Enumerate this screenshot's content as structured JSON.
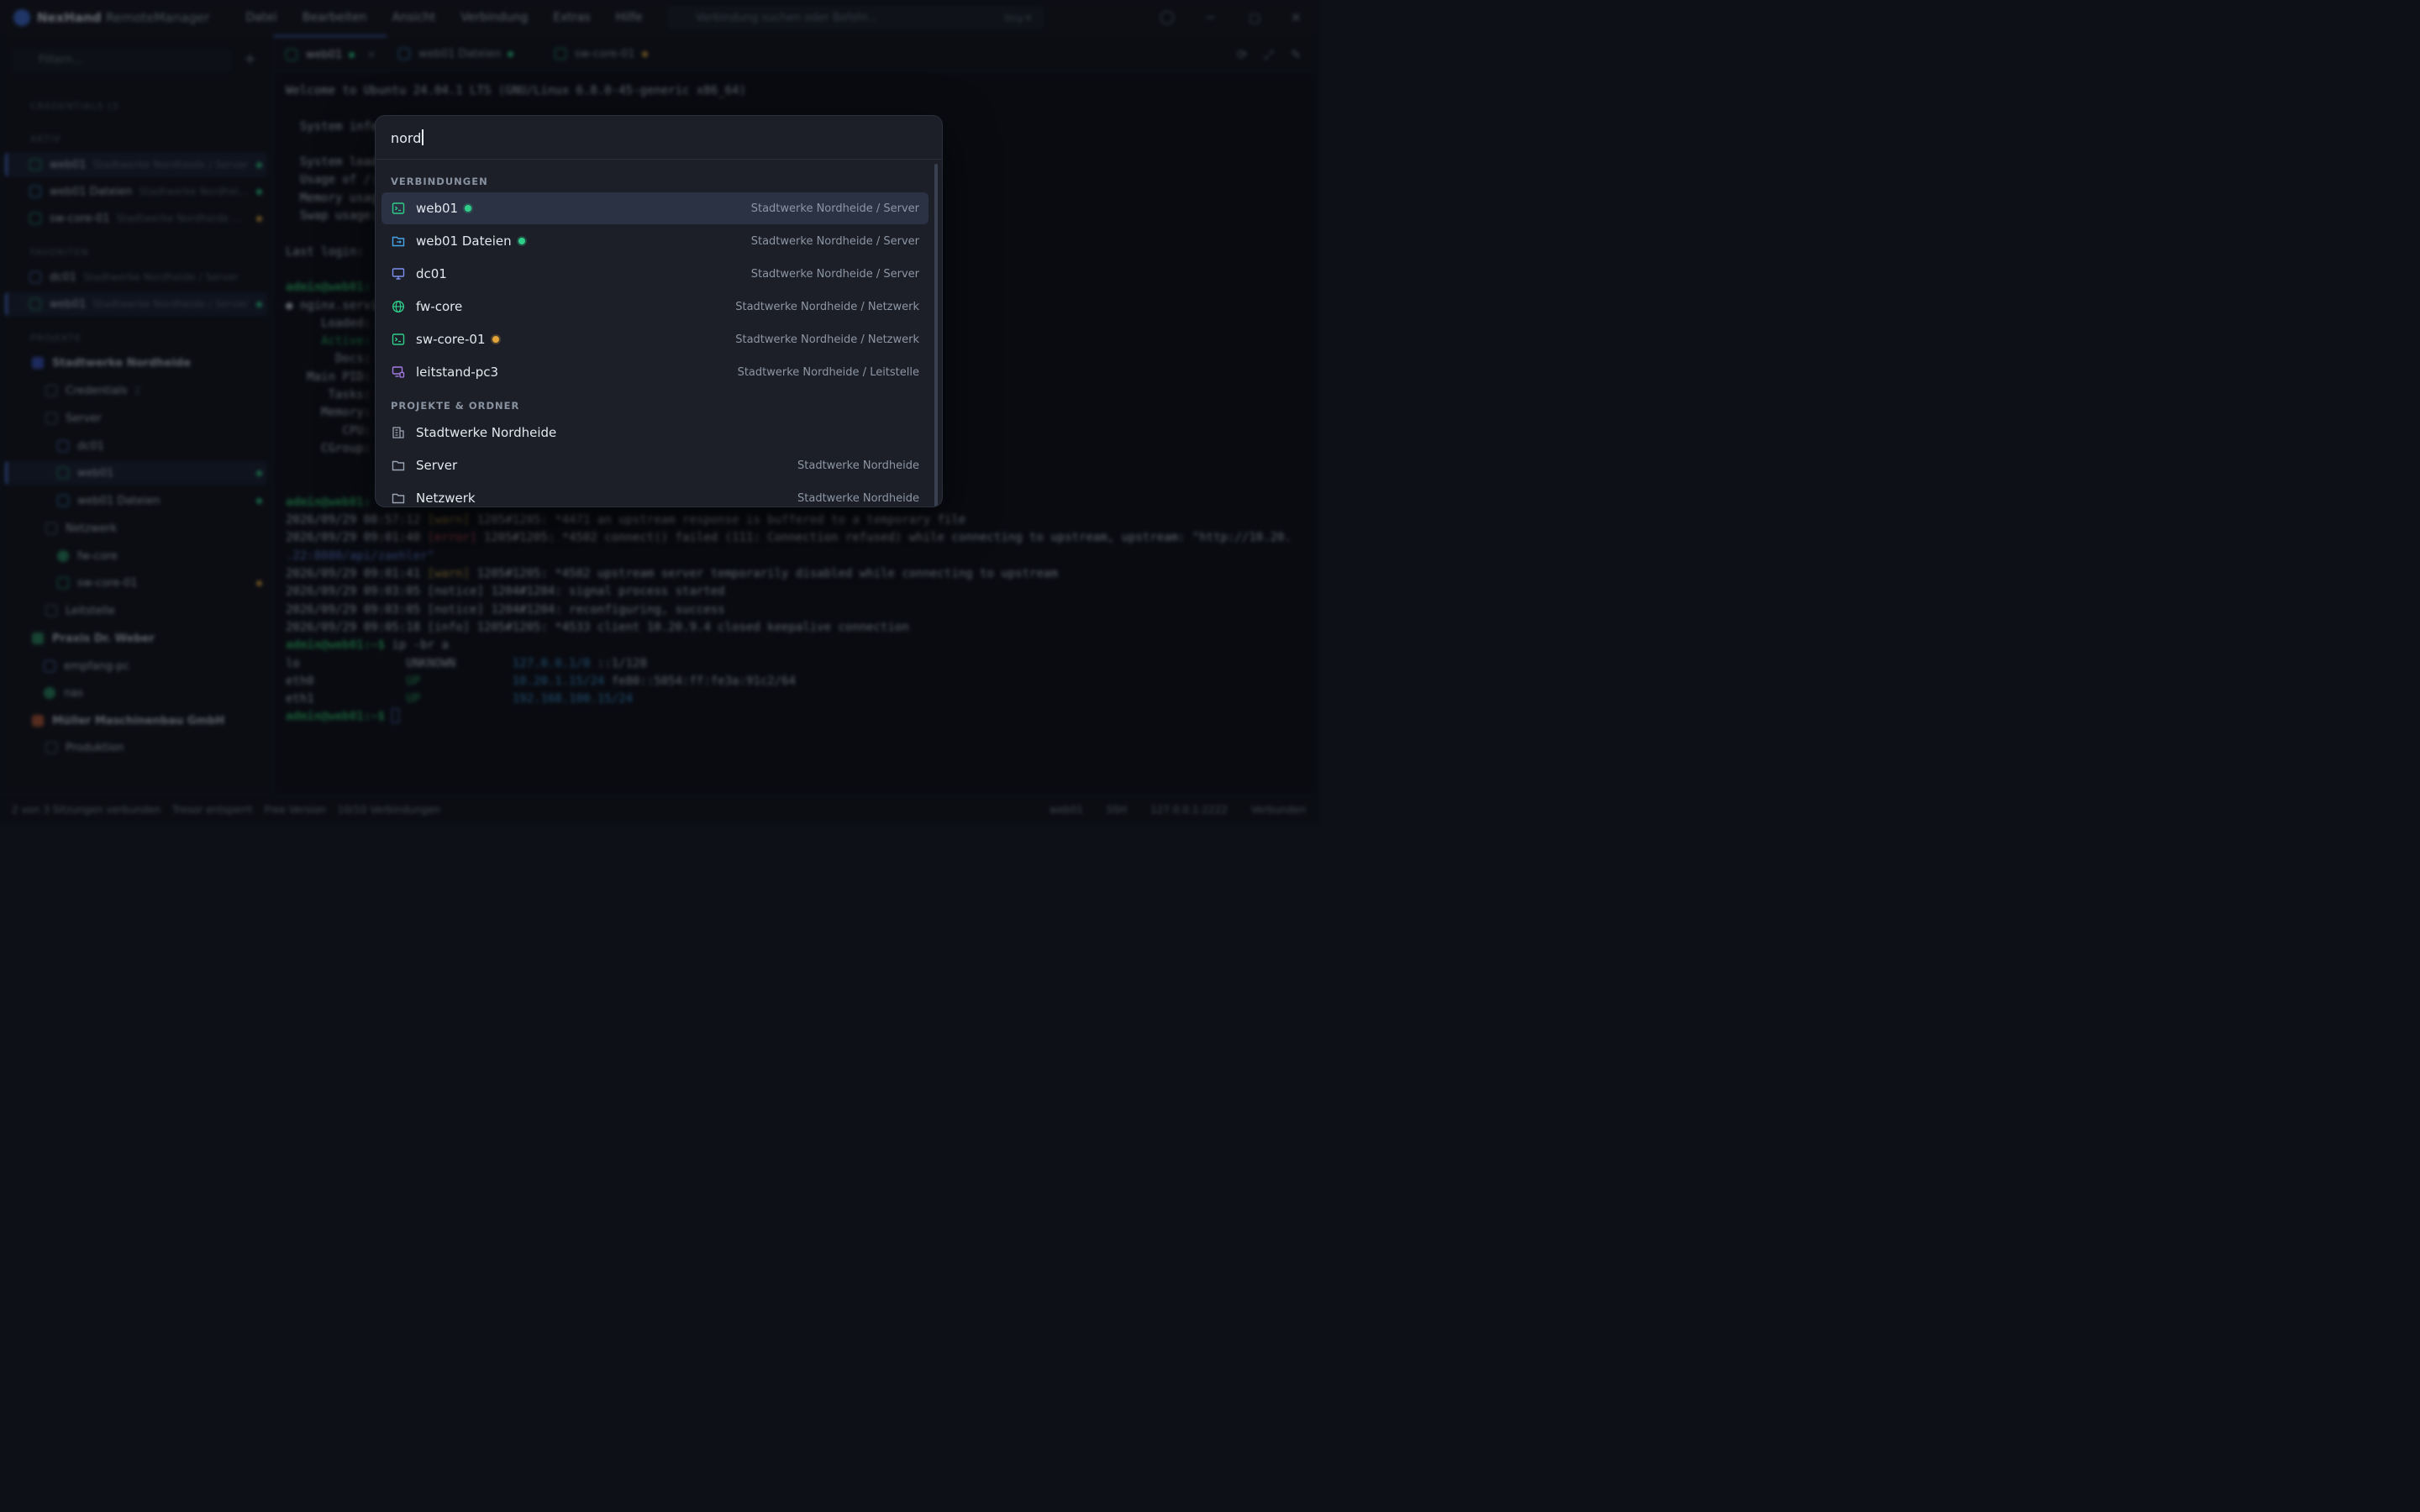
{
  "titlebar": {
    "brand": "NexHand",
    "brand_sub": "RemoteManager",
    "menu": [
      "Datei",
      "Bearbeiten",
      "Ansicht",
      "Verbindung",
      "Extras",
      "Hilfe"
    ],
    "search_placeholder": "Verbindung suchen oder Befehl...",
    "search_shortcut": "Strg K"
  },
  "sidebar": {
    "filter_placeholder": "Filtern...",
    "credentials_head": "CREDENTIALS (3",
    "active_head": "AKTIV",
    "favorites_head": "FAVORITEN",
    "projects_head": "PROJEKTE",
    "active": [
      {
        "name": "web01",
        "path": "Stadtwerke Nordheide / Server"
      },
      {
        "name": "web01 Dateien",
        "path": "Stadtwerke Nordhei..."
      },
      {
        "name": "sw-core-01",
        "path": "Stadtwerke Nordheide ..."
      }
    ],
    "favorites": [
      {
        "name": "dc01",
        "path": "Stadtwerke Nordheide / Server"
      },
      {
        "name": "web01",
        "path": "Stadtwerke Nordheide / Server"
      }
    ],
    "tree": [
      {
        "label": "Stadtwerke Nordheide"
      },
      {
        "label": "Credentials",
        "count": "2"
      },
      {
        "label": "Server"
      },
      {
        "label": "dc01"
      },
      {
        "label": "web01"
      },
      {
        "label": "web01 Dateien"
      },
      {
        "label": "Netzwerk"
      },
      {
        "label": "fw-core"
      },
      {
        "label": "sw-core-01"
      },
      {
        "label": "Leitstelle"
      },
      {
        "label": "Praxis Dr. Weber"
      },
      {
        "label": "empfang-pc"
      },
      {
        "label": "nas"
      },
      {
        "label": "Müller Maschinenbau GmbH"
      },
      {
        "label": "Produktion"
      }
    ]
  },
  "tabs": [
    {
      "label": "web01"
    },
    {
      "label": "web01 Dateien"
    },
    {
      "label": "sw-core-01"
    }
  ],
  "terminal": {
    "lines": [
      "Welcome to Ubuntu 24.04.1 LTS (GNU/Linux 6.8.0-45-generic x86_64)",
      "",
      "  System information",
      "",
      "  System load:",
      "  Usage of /:",
      "  Memory usage:",
      "  Swap usage:",
      "",
      "Last login:",
      "",
      "admin@web01:",
      "● nginx.service",
      "     Loaded:",
      "     Active:",
      "       Docs:",
      "   Main PID:",
      "      Tasks:",
      "     Memory:",
      "        CPU:",
      "     CGroup:"
    ],
    "log": [
      {
        "ts": "2026/09/29 08:57:12",
        "lvl": "[warn]",
        "msg": " 1205#1205: *4471 an upstream response is buffered to a temporary file"
      },
      {
        "ts": "2026/09/29 09:01:40",
        "lvl": "[error]",
        "msg": " 1205#1205: *4502 connect() failed (111: Connection refused) while connecting to upstream, upstream: \"http://10.20."
      },
      {
        "ts": "",
        "lvl": "",
        "msg": ".22:8080/api/zaehler\""
      },
      {
        "ts": "2026/09/29 09:01:41",
        "lvl": "[warn]",
        "msg": " 1205#1205: *4502 upstream server temporarily disabled while connecting to upstream"
      },
      {
        "ts": "2026/09/29 09:03:05",
        "lvl": "[notice]",
        "msg": " 1204#1204: signal process started"
      },
      {
        "ts": "2026/09/29 09:03:05",
        "lvl": "[notice]",
        "msg": " 1204#1204: reconfiguring, success"
      },
      {
        "ts": "2026/09/29 09:05:18",
        "lvl": "[info]",
        "msg": " 1205#1205: *4533 client 10.20.9.4 closed keepalive connection"
      }
    ],
    "prompt": "admin@web01:~$",
    "cmd": " ip -br a",
    "ip_rows": [
      {
        "ifc": "lo",
        "state": "UNKNOWN",
        "addr": "127.0.0.1/8",
        "extra": " ::1/128"
      },
      {
        "ifc": "eth0",
        "state": "UP",
        "addr": "10.20.1.15/24",
        "extra": " fe80::5054:ff:fe3a:91c2/64"
      },
      {
        "ifc": "eth1",
        "state": "UP",
        "addr": "192.168.100.15/24",
        "extra": ""
      }
    ]
  },
  "statusbar": {
    "sessions": "2 von 3 Sitzungen verbunden",
    "vault": "Tresor entsperrt",
    "license": "Free Version",
    "limit": "10/10 Verbindungen",
    "host": "web01",
    "proto": "SSH",
    "addr": "127.0.0.1:2222",
    "state": "Verbunden"
  },
  "palette": {
    "query": "nord",
    "section_connections": "VERBINDUNGEN",
    "section_projects": "PROJEKTE & ORDNER",
    "connections": [
      {
        "name": "web01",
        "path": "Stadtwerke Nordheide / Server",
        "icon": "terminal-icon",
        "status": "green"
      },
      {
        "name": "web01 Dateien",
        "path": "Stadtwerke Nordheide / Server",
        "icon": "file-transfer-icon",
        "status": "green"
      },
      {
        "name": "dc01",
        "path": "Stadtwerke Nordheide / Server",
        "icon": "monitor-icon",
        "status": ""
      },
      {
        "name": "fw-core",
        "path": "Stadtwerke Nordheide / Netzwerk",
        "icon": "globe-icon",
        "status": ""
      },
      {
        "name": "sw-core-01",
        "path": "Stadtwerke Nordheide / Netzwerk",
        "icon": "terminal-icon",
        "status": "orange"
      },
      {
        "name": "leitstand-pc3",
        "path": "Stadtwerke Nordheide / Leitstelle",
        "icon": "remote-desktop-icon",
        "status": ""
      }
    ],
    "projects": [
      {
        "name": "Stadtwerke Nordheide",
        "path": "",
        "icon": "building-icon"
      },
      {
        "name": "Server",
        "path": "Stadtwerke Nordheide",
        "icon": "folder-icon"
      },
      {
        "name": "Netzwerk",
        "path": "Stadtwerke Nordheide",
        "icon": "folder-icon"
      }
    ]
  },
  "colors": {
    "accent": "#4e7ae0",
    "status_green": "#2fcf8a",
    "status_orange": "#e3a53a",
    "terminal_green": "#2fbf6a",
    "remote_purple": "#a77be6"
  }
}
